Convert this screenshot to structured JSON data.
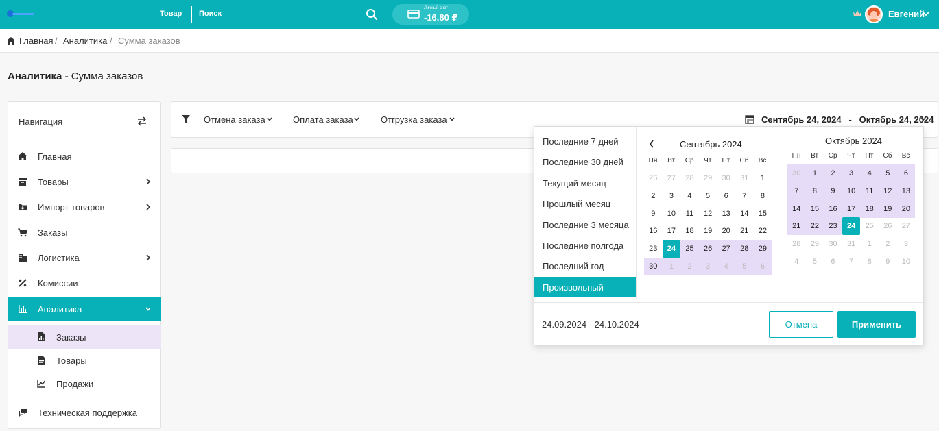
{
  "header": {
    "nav_product": "Товар",
    "nav_search": "Поиск",
    "wallet_label": "Личный счет",
    "wallet_value": "-16.80 ₽",
    "user_name": "Евгений",
    "accent_color": "#08b0b8"
  },
  "breadcrumb": [
    "Главная",
    "/",
    "Аналитика",
    "/",
    "Сумма заказов"
  ],
  "page_title": {
    "bold": "Аналитика",
    "rest": " - Сумма заказов"
  },
  "sidebar": {
    "heading": "Навигация",
    "items": [
      {
        "label": "Главная",
        "icon": "home-icon"
      },
      {
        "label": "Товары",
        "icon": "box-icon"
      },
      {
        "label": "Импорт товаров",
        "icon": "import-folder-icon"
      },
      {
        "label": "Заказы",
        "icon": "cart-icon"
      },
      {
        "label": "Логистика",
        "icon": "buildings-icon"
      },
      {
        "label": "Комиссии",
        "icon": "percent-icon"
      },
      {
        "label": "Аналитика",
        "icon": "bar-chart-icon"
      }
    ],
    "sub_items": [
      {
        "label": "Заказы",
        "icon": "report-icon"
      },
      {
        "label": "Товары",
        "icon": "report-icon"
      },
      {
        "label": "Продажи",
        "icon": "line-chart-icon"
      }
    ],
    "support": {
      "label": "Техническая поддержка",
      "icon": "chat-icon"
    }
  },
  "filters": {
    "items": [
      "Отмена заказа",
      "Оплата заказа",
      "Отгрузка заказа"
    ],
    "date_start": "Сентябрь 24, 2024",
    "date_sep": "-",
    "date_end": "Октябрь 24, 2024"
  },
  "picker": {
    "ranges": [
      "Последние 7 дней",
      "Последние 30 дней",
      "Текущий месяц",
      "Прошлый месяц",
      "Последние 3 месяца",
      "Последние полгода",
      "Последний год",
      "Произвольный"
    ],
    "active_range": 7,
    "weekdays": [
      "Пн",
      "Вт",
      "Ср",
      "Чт",
      "Пт",
      "Сб",
      "Вс"
    ],
    "left_title": "Сентябрь 2024",
    "right_title": "Октябрь 2024",
    "left_days": [
      "26",
      "27",
      "28",
      "29",
      "30",
      "31",
      "1",
      "2",
      "3",
      "4",
      "5",
      "6",
      "7",
      "8",
      "9",
      "10",
      "11",
      "12",
      "13",
      "14",
      "15",
      "16",
      "17",
      "18",
      "19",
      "20",
      "21",
      "22",
      "23",
      "24",
      "25",
      "26",
      "27",
      "28",
      "29",
      "30",
      "1",
      "2",
      "3",
      "4",
      "5",
      "6"
    ],
    "right_days": [
      "30",
      "1",
      "2",
      "3",
      "4",
      "5",
      "6",
      "7",
      "8",
      "9",
      "10",
      "11",
      "12",
      "13",
      "14",
      "15",
      "16",
      "17",
      "18",
      "19",
      "20",
      "21",
      "22",
      "23",
      "24",
      "25",
      "26",
      "27",
      "28",
      "29",
      "30",
      "31",
      "1",
      "2",
      "3",
      "4",
      "5",
      "6",
      "7",
      "8",
      "9",
      "10"
    ],
    "selected_text": "24.09.2024 - 24.10.2024",
    "cancel_label": "Отмена",
    "apply_label": "Применить"
  }
}
